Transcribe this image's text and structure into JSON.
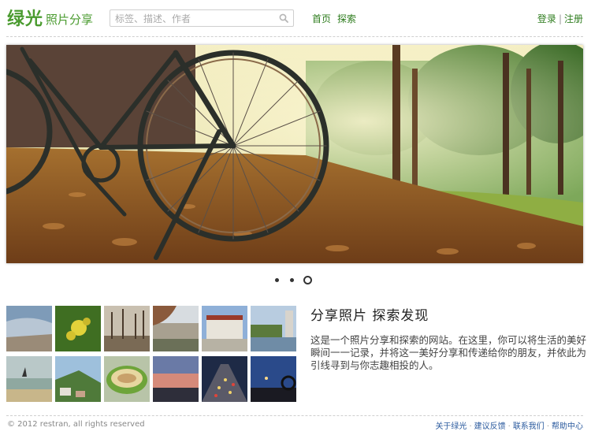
{
  "header": {
    "logo_main": "绿光",
    "logo_sub": "照片分享",
    "search_placeholder": "标签、描述、作者",
    "nav": [
      "首页",
      "探索"
    ],
    "login": "登录",
    "auth_sep": "|",
    "register": "注册"
  },
  "slider": {
    "dot_count": 3,
    "active_index": 2
  },
  "intro": {
    "title": "分享照片 探索发现",
    "body": "这是一个照片分享和探索的网站。在这里，你可以将生活的美好瞬间一一记录，并将这一美好分享和传递给你的朋友，并依此为引线寻到与你志趣相投的人。"
  },
  "footer": {
    "copyright": "© 2012 restran, all rights reserved",
    "links": [
      "关于绿光",
      "建议反馈",
      "联系我们",
      "帮助中心"
    ],
    "sep": "·"
  },
  "colors": {
    "brand_green": "#4a9b2f",
    "nav_green": "#2f7d1f",
    "footer_link": "#2a5a9e"
  }
}
